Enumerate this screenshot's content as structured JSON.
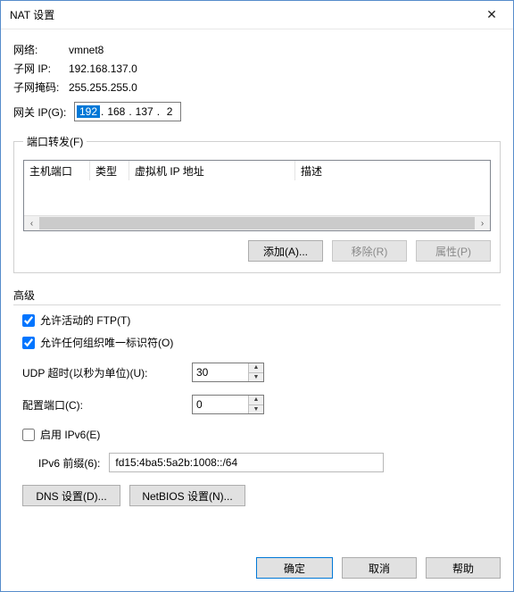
{
  "window": {
    "title": "NAT 设置"
  },
  "info": {
    "network_label": "网络:",
    "network_value": "vmnet8",
    "subnet_ip_label": "子网 IP:",
    "subnet_ip_value": "192.168.137.0",
    "subnet_mask_label": "子网掩码:",
    "subnet_mask_value": "255.255.255.0",
    "gateway_label": "网关 IP(G):",
    "gateway_seg1": "192",
    "gateway_seg2": "168",
    "gateway_seg3": "137",
    "gateway_seg4": "2"
  },
  "port_forward": {
    "legend": "端口转发(F)",
    "col_host": "主机端口",
    "col_type": "类型",
    "col_vmip": "虚拟机 IP 地址",
    "col_desc": "描述",
    "add_btn": "添加(A)...",
    "remove_btn": "移除(R)",
    "props_btn": "属性(P)"
  },
  "advanced": {
    "title": "高级",
    "allow_ftp": "允许活动的 FTP(T)",
    "allow_oui": "允许任何组织唯一标识符(O)",
    "udp_label": "UDP 超时(以秒为单位)(U):",
    "udp_value": "30",
    "cfg_port_label": "配置端口(C):",
    "cfg_port_value": "0",
    "ipv6_enable": "启用 IPv6(E)",
    "ipv6_prefix_label": "IPv6 前缀(6):",
    "ipv6_prefix_value": "fd15:4ba5:5a2b:1008::/64",
    "dns_btn": "DNS 设置(D)...",
    "netbios_btn": "NetBIOS 设置(N)..."
  },
  "footer": {
    "ok": "确定",
    "cancel": "取消",
    "help": "帮助"
  }
}
